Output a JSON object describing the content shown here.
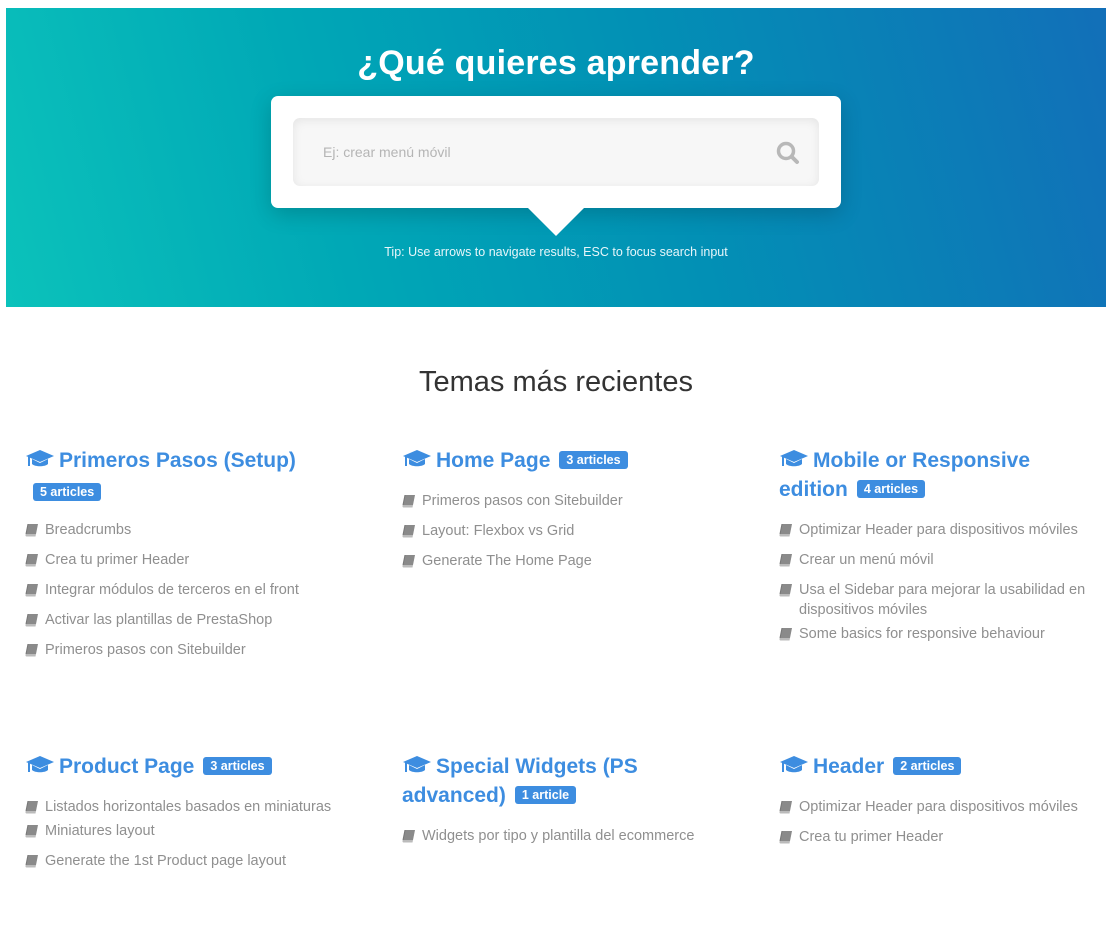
{
  "hero": {
    "title": "¿Qué quieres aprender?",
    "search_placeholder": "Ej: crear menú móvil",
    "search_value": "",
    "search_icon": "search-icon",
    "tip": "Tip: Use arrows to navigate results, ESC to focus search input"
  },
  "section": {
    "title": "Temas más recientes"
  },
  "colors": {
    "accent": "#3d8de0",
    "hero_gradient_start": "#0bc2bb",
    "hero_gradient_end": "#126fb8",
    "article_text": "#8f8f8f"
  },
  "topics": [
    {
      "title": "Primeros Pasos (Setup)",
      "badge": "5 articles",
      "icon": "graduation-cap-icon",
      "articles": [
        "Breadcrumbs",
        "Crea tu primer Header",
        "Integrar módulos de terceros en el front",
        "Activar las plantillas de PrestaShop",
        "Primeros pasos con Sitebuilder"
      ]
    },
    {
      "title": "Home Page",
      "badge": "3 articles",
      "icon": "graduation-cap-icon",
      "articles": [
        "Primeros pasos con Sitebuilder",
        "Layout: Flexbox vs Grid",
        "Generate The Home Page"
      ]
    },
    {
      "title": "Mobile or Responsive edition",
      "badge": "4 articles",
      "icon": "graduation-cap-icon",
      "articles": [
        "Optimizar Header para dispositivos móviles",
        "Crear un menú móvil",
        "Usa el Sidebar para mejorar la usabilidad en dispositivos móviles",
        "Some basics for responsive behaviour"
      ]
    },
    {
      "title": "Product Page",
      "badge": "3 articles",
      "icon": "graduation-cap-icon",
      "articles": [
        "Listados horizontales basados en miniaturas",
        "Miniatures layout",
        "Generate the 1st Product page layout"
      ]
    },
    {
      "title": "Special Widgets (PS advanced)",
      "badge": "1 article",
      "icon": "graduation-cap-icon",
      "articles": [
        "Widgets por tipo y plantilla del ecommerce"
      ]
    },
    {
      "title": "Header",
      "badge": "2 articles",
      "icon": "graduation-cap-icon",
      "articles": [
        "Optimizar Header para dispositivos móviles",
        "Crea tu primer Header"
      ]
    }
  ]
}
